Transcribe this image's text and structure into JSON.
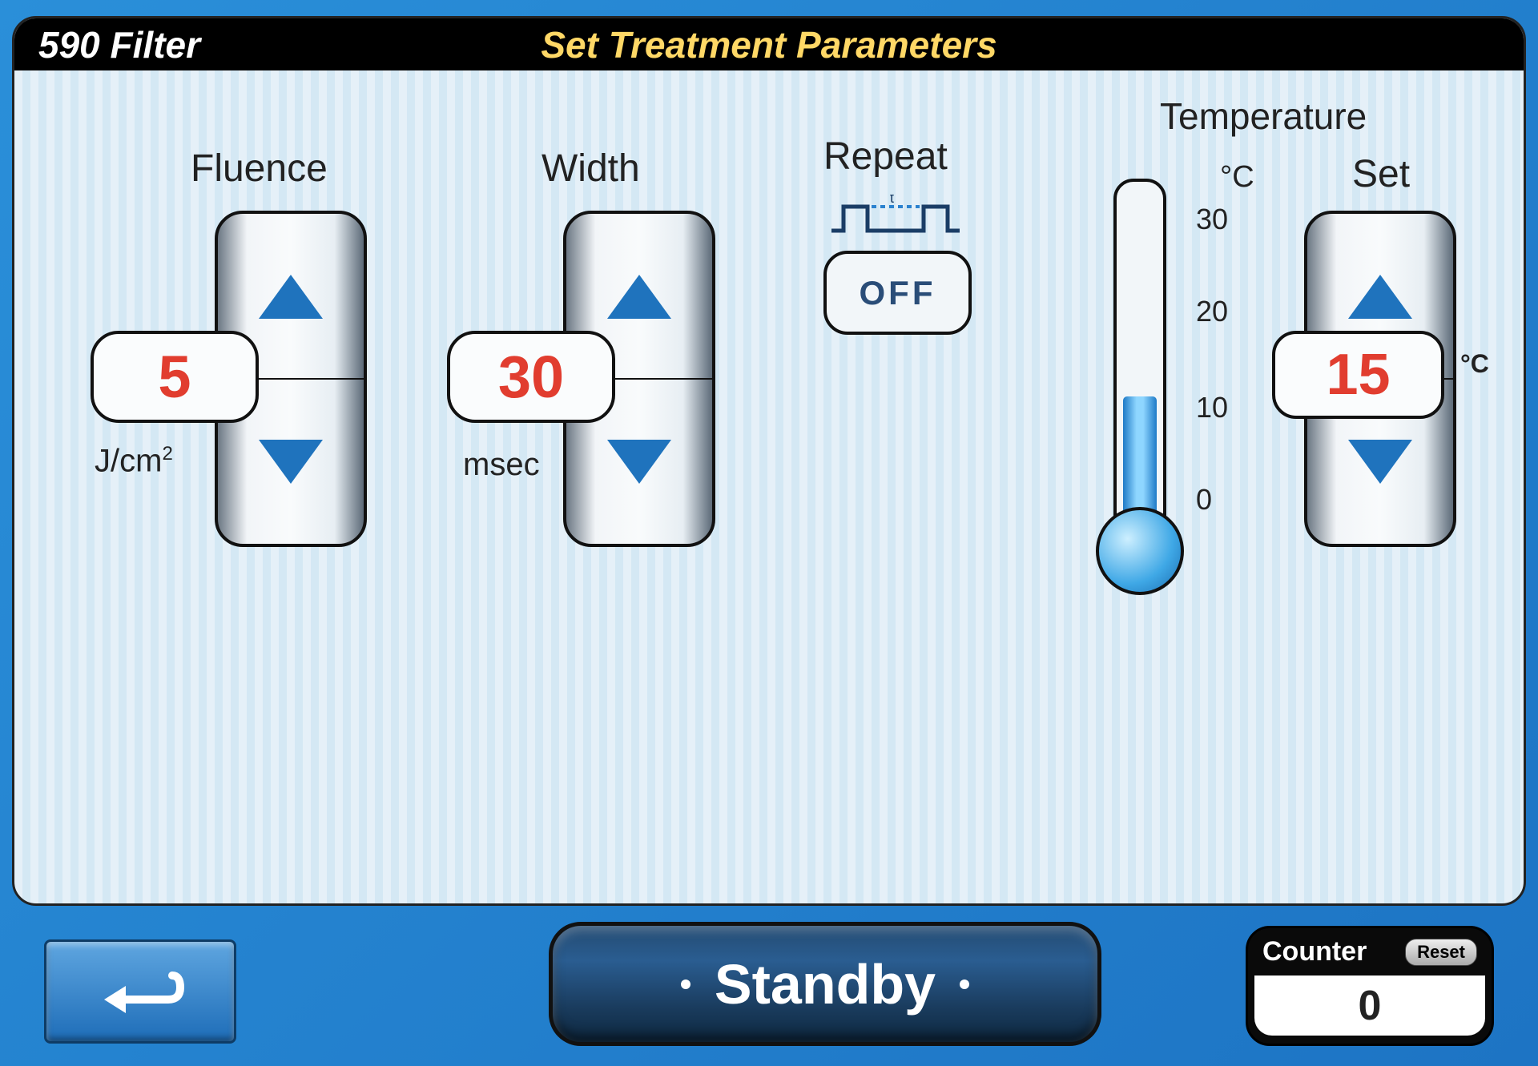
{
  "header": {
    "filter": "590 Filter",
    "title": "Set Treatment Parameters"
  },
  "fluence": {
    "label": "Fluence",
    "value": "5",
    "unit": "J/cm",
    "unit_sup": "2"
  },
  "width": {
    "label": "Width",
    "value": "30",
    "unit": "msec"
  },
  "repeat": {
    "label": "Repeat",
    "state": "OFF",
    "icon_t": "t"
  },
  "temperature": {
    "header": "Temperature",
    "unit_col": "°C",
    "set_label": "Set",
    "set_value": "15",
    "set_unit": "°C",
    "current_fill_percent": 38,
    "ticks": {
      "t30": "30",
      "t20": "20",
      "t10": "10",
      "t0": "0"
    }
  },
  "footer": {
    "standby": "Standby",
    "counter_label": "Counter",
    "counter_value": "0",
    "reset_label": "Reset"
  }
}
